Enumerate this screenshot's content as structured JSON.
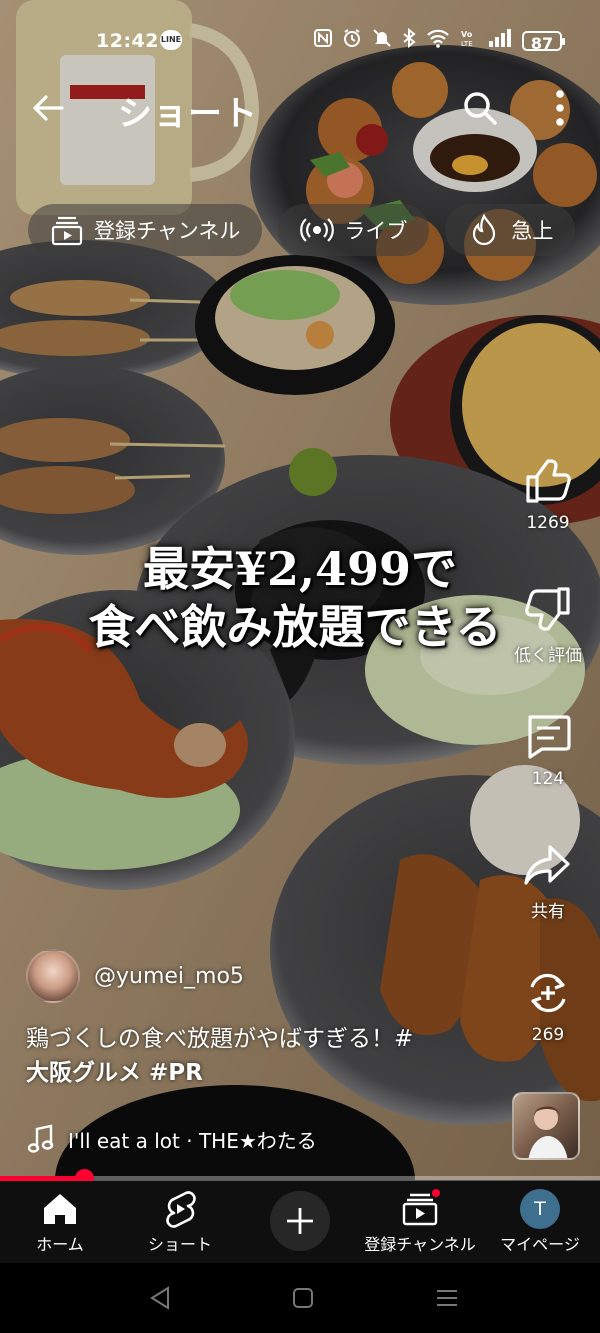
{
  "status_bar": {
    "time": "12:42",
    "line_badge": "LINE",
    "battery": "87"
  },
  "top_bar": {
    "title": "ショート",
    "back_icon": "arrow-left-icon",
    "search_icon": "search-icon",
    "more_icon": "more-vertical-icon"
  },
  "chips": [
    {
      "label": "登録チャンネル",
      "icon": "subscriptions-icon"
    },
    {
      "label": "ライブ",
      "icon": "live-icon"
    },
    {
      "label": "急上",
      "icon": "trending-icon"
    }
  ],
  "video": {
    "overlay_line1": "最安¥2,499で",
    "overlay_line2": "食べ飲み放題できる"
  },
  "actions": {
    "like_count": "1269",
    "dislike_label": "低く評価",
    "comment_count": "124",
    "share_label": "共有",
    "remix_count": "269"
  },
  "channel": {
    "handle": "@yumei_mo5"
  },
  "caption": {
    "text": "鶏づくしの食べ放題がやばすぎる！#",
    "tags": "大阪グルメ #PR"
  },
  "music": {
    "text": "I'll eat a lot · THE★わたる"
  },
  "progress": {
    "fraction": 0.14
  },
  "bottom_nav": {
    "home": "ホーム",
    "shorts": "ショート",
    "subscriptions": "登録チャンネル",
    "mypage": "マイページ",
    "mypage_initial": "T"
  },
  "colors": {
    "accent": "#ff0033",
    "nav_bg": "#0f0f0f"
  }
}
